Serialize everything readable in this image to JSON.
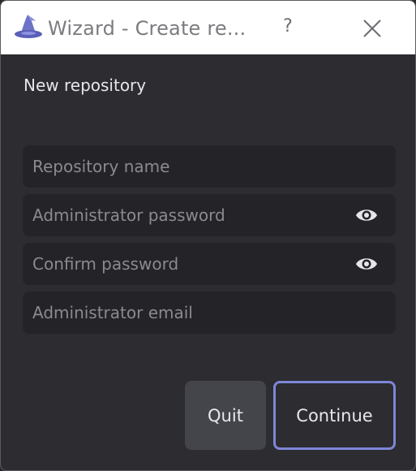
{
  "titlebar": {
    "title": "Wizard - Create re...",
    "help_label": "?",
    "app_icon": "wizard-hat-icon",
    "close_icon": "close-icon"
  },
  "form": {
    "heading": "New repository",
    "fields": [
      {
        "placeholder": "Repository name",
        "value": ""
      },
      {
        "placeholder": "Administrator password",
        "value": "",
        "icon": "eye-icon"
      },
      {
        "placeholder": "Confirm password",
        "value": "",
        "icon": "eye-icon"
      },
      {
        "placeholder": "Administrator email",
        "value": ""
      }
    ]
  },
  "buttons": {
    "quit_label": "Quit",
    "continue_label": "Continue"
  },
  "colors": {
    "background": "#2c2c31",
    "field_background": "#232328",
    "accent": "#7d86d6",
    "titlebar": "#ffffff"
  }
}
